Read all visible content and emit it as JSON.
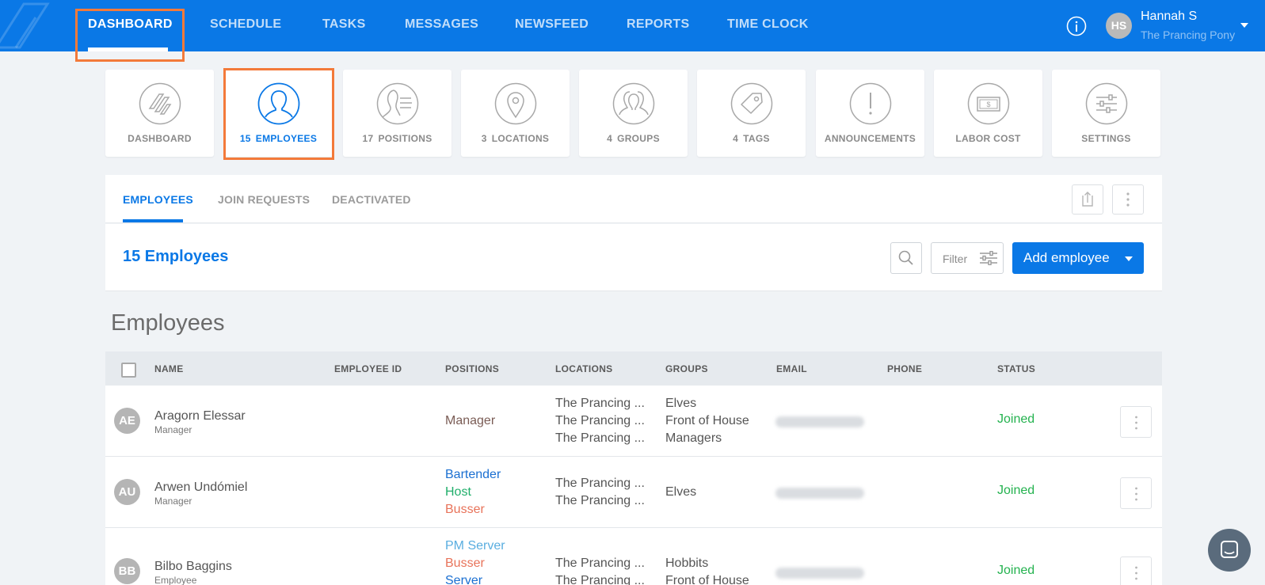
{
  "topnav": {
    "items": [
      "DASHBOARD",
      "SCHEDULE",
      "TASKS",
      "MESSAGES",
      "NEWSFEED",
      "REPORTS",
      "TIME CLOCK"
    ],
    "active": "DASHBOARD",
    "user": {
      "initials": "HS",
      "name": "Hannah S",
      "org": "The Prancing Pony"
    }
  },
  "cards": [
    {
      "num": "",
      "label": "DASHBOARD",
      "icon": "dashboard-icon"
    },
    {
      "num": "15",
      "label": "EMPLOYEES",
      "icon": "person-icon"
    },
    {
      "num": "17",
      "label": "POSITIONS",
      "icon": "positions-icon"
    },
    {
      "num": "3",
      "label": "LOCATIONS",
      "icon": "location-pin-icon"
    },
    {
      "num": "4",
      "label": "GROUPS",
      "icon": "group-icon"
    },
    {
      "num": "4",
      "label": "TAGS",
      "icon": "tag-icon"
    },
    {
      "num": "",
      "label": "ANNOUNCEMENTS",
      "icon": "exclamation-icon"
    },
    {
      "num": "",
      "label": "LABOR COST",
      "icon": "money-icon"
    },
    {
      "num": "",
      "label": "SETTINGS",
      "icon": "sliders-icon"
    }
  ],
  "tabs": {
    "items": [
      "EMPLOYEES",
      "JOIN REQUESTS",
      "DEACTIVATED"
    ],
    "active": "EMPLOYEES"
  },
  "list_header": {
    "count_title": "15 Employees",
    "filter_label": "Filter",
    "add_label": "Add employee"
  },
  "section_title": "Employees",
  "columns": [
    "NAME",
    "EMPLOYEE ID",
    "POSITIONS",
    "LOCATIONS",
    "GROUPS",
    "EMAIL",
    "PHONE",
    "STATUS"
  ],
  "rows": [
    {
      "initials": "AE",
      "name": "Aragorn Elessar",
      "role": "Manager",
      "positions": [
        {
          "text": "Manager",
          "color": "#7a5c55"
        }
      ],
      "locations": [
        "The Prancing ...",
        "The Prancing ...",
        "The Prancing ..."
      ],
      "groups": [
        "Elves",
        "Front of House",
        "Managers"
      ],
      "status": "Joined"
    },
    {
      "initials": "AU",
      "name": "Arwen Undómiel",
      "role": "Manager",
      "positions": [
        {
          "text": "Bartender",
          "color": "#1a6fd1"
        },
        {
          "text": "Host",
          "color": "#1fae6a"
        },
        {
          "text": "Busser",
          "color": "#e8735a"
        }
      ],
      "locations": [
        "The Prancing ...",
        "The Prancing ..."
      ],
      "groups": [
        "Elves"
      ],
      "status": "Joined"
    },
    {
      "initials": "BB",
      "name": "Bilbo Baggins",
      "role": "Employee",
      "positions": [
        {
          "text": "PM Server",
          "color": "#5aaee0"
        },
        {
          "text": "Busser",
          "color": "#e8735a"
        },
        {
          "text": "Server",
          "color": "#1a6fd1"
        }
      ],
      "locations": [
        "The Prancing ...",
        "The Prancing ..."
      ],
      "groups": [
        "Hobbits",
        "Front of House"
      ],
      "status": "Joined"
    }
  ]
}
